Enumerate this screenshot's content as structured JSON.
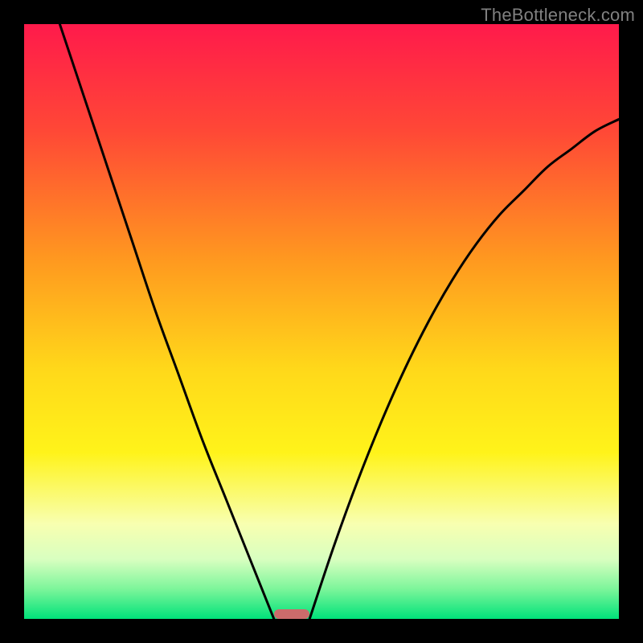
{
  "watermark": {
    "text": "TheBottleneck.com"
  },
  "chart_data": {
    "type": "line",
    "title": "",
    "xlabel": "",
    "ylabel": "",
    "xlim": [
      0,
      100
    ],
    "ylim": [
      0,
      100
    ],
    "grid": false,
    "legend": null,
    "gradient_stops": [
      {
        "offset": 0.0,
        "color": "#ff1a4b"
      },
      {
        "offset": 0.18,
        "color": "#ff4836"
      },
      {
        "offset": 0.4,
        "color": "#ff9a1f"
      },
      {
        "offset": 0.58,
        "color": "#ffd81a"
      },
      {
        "offset": 0.72,
        "color": "#fff31a"
      },
      {
        "offset": 0.84,
        "color": "#f8ffb0"
      },
      {
        "offset": 0.9,
        "color": "#d8ffc0"
      },
      {
        "offset": 0.95,
        "color": "#7cf59a"
      },
      {
        "offset": 1.0,
        "color": "#00e27a"
      }
    ],
    "series": [
      {
        "name": "left-curve",
        "x": [
          6,
          10,
          14,
          18,
          22,
          26,
          30,
          34,
          38,
          42
        ],
        "y": [
          100,
          88,
          76,
          64,
          52,
          41,
          30,
          20,
          10,
          0
        ]
      },
      {
        "name": "right-curve",
        "x": [
          48,
          52,
          56,
          60,
          64,
          68,
          72,
          76,
          80,
          84,
          88,
          92,
          96,
          100
        ],
        "y": [
          0,
          12,
          23,
          33,
          42,
          50,
          57,
          63,
          68,
          72,
          76,
          79,
          82,
          84
        ]
      }
    ],
    "marker": {
      "x_center": 45,
      "width_pct": 6,
      "color": "#cc6b6b"
    },
    "curve_stroke": "#000000",
    "curve_width": 3
  }
}
